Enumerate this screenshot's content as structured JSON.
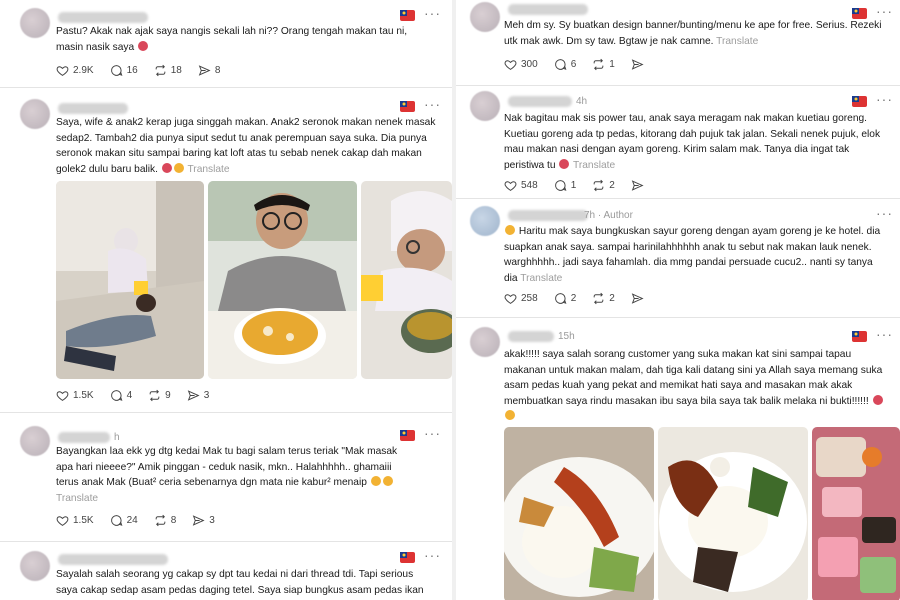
{
  "left_posts": [
    {
      "meta": "",
      "text": "Pastu? Akak nak ajak saya nangis sekali lah ni?? Orang tengah makan tau ni, masin nasik saya",
      "translate": "",
      "likes": "2.9K",
      "replies": "16",
      "reposts": "18",
      "shares": "8"
    },
    {
      "meta": "",
      "text": "Saya, wife & anak2 kerap juga singgah makan. Anak2 seronok makan nenek masak sedap2. Tambah2 dia punya siput sedut tu anak perempuan saya suka. Dia punya seronok makan situ sampai baring kat loft atas tu sebab nenek cakap dah makan golek2 dulu baru balik.",
      "translate": "Translate",
      "likes": "1.5K",
      "replies": "4",
      "reposts": "9",
      "shares": "3"
    },
    {
      "meta": "h",
      "text": "Bayangkan laa ekk yg dtg kedai Mak tu bagi salam terus teriak \"Mak masak apa hari nieeee?\" Amik pinggan - ceduk nasik, mkn.. Halahhhhh.. ghamaiii terus anak Mak (Buat² ceria sebenarnya dgn mata nie kabur² menaip",
      "translate": "Translate",
      "likes": "1.5K",
      "replies": "24",
      "reposts": "8",
      "shares": "3"
    },
    {
      "meta": "",
      "text": "Sayalah salah seorang yg cakap sy dpt tau kedai ni dari thread tdi. Tapi serious saya cakap sedap asam pedas daging tetel. Saya siap bungkus asam pedas ikan",
      "translate": ""
    }
  ],
  "right_posts": [
    {
      "meta": "",
      "text": "Meh dm sy. Sy buatkan design banner/bunting/menu ke ape for free. Serius. Rezeki utk mak awk. Dm sy taw. Bgtaw je nak camne.",
      "translate": "Translate",
      "likes": "300",
      "replies": "6",
      "reposts": "1"
    },
    {
      "meta": "4h",
      "text": "Nak bagitau mak sis power tau, anak saya meragam nak makan kuetiau goreng. Kuetiau goreng ada tp pedas, kitorang dah pujuk tak jalan. Sekali nenek pujuk, elok mau makan nasi dengan ayam goreng. Kirim salam mak. Tanya dia ingat tak peristiwa tu",
      "translate": "Translate",
      "likes": "548",
      "replies": "1",
      "reposts": "2"
    },
    {
      "meta": "7h · Author",
      "text": "Haritu mak saya bungkuskan sayur goreng dengan ayam goreng je ke hotel. dia suapkan anak saya. sampai harinilahhhhhh anak tu sebut nak makan lauk nenek. warghhhhh.. jadi saya fahamlah. dia mmg pandai persuade cucu2.. nanti sy tanya dia",
      "translate": "Translate",
      "likes": "258",
      "replies": "2",
      "reposts": "2"
    },
    {
      "meta": "15h",
      "text": "akak!!!!! saya salah sorang customer yang suka makan kat sini sampai tapau makanan untuk makan malam, dah tiga kali datang sini ya Allah saya memang suka asam pedas kuah yang pekat and memikat hati saya and masakan mak akak membuatkan saya rindu masakan ibu saya bila saya tak balik melaka ni bukti!!!!!!",
      "translate": ""
    }
  ],
  "icons": [
    "heart-icon",
    "reply-icon",
    "repost-icon",
    "share-icon",
    "more-icon",
    "flag-icon"
  ],
  "colors": {
    "translate": "#9d9d9d",
    "text": "#1a1a1a",
    "divider": "#e4e4e4"
  }
}
